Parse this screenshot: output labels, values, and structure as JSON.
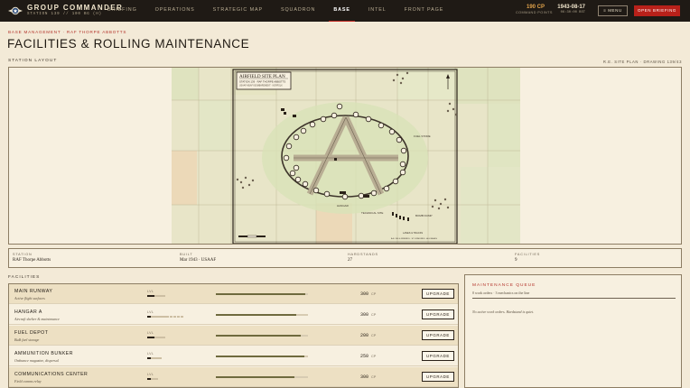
{
  "app": {
    "title": "GROUP COMMANDER",
    "subtitle": "STATION 139 // 100 BG (H)"
  },
  "nav": {
    "items": [
      {
        "label": "BRIEFING",
        "active": false
      },
      {
        "label": "OPERATIONS",
        "active": false
      },
      {
        "label": "STRATEGIC MAP",
        "active": false
      },
      {
        "label": "SQUADRON",
        "active": false
      },
      {
        "label": "BASE",
        "active": true
      },
      {
        "label": "INTEL",
        "active": false
      },
      {
        "label": "FRONT PAGE",
        "active": false
      }
    ]
  },
  "status": {
    "cp_value": "190 CP",
    "cp_label": "COMMAND POINTS",
    "date": "1943-08-17",
    "time": "06:30:00 BST",
    "menu_label": "≡ MENU",
    "briefing_label": "OPEN BRIEFING"
  },
  "header": {
    "breadcrumb": "BASE MANAGEMENT · RAF THORPE ABBOTTS",
    "title": "FACILITIES & ROLLING MAINTENANCE"
  },
  "layout_section": {
    "label": "STATION LAYOUT",
    "drawing_ref": "R.E. SITE PLAN · DRAWING 139/43"
  },
  "site_plan": {
    "title": "AIRFIELD SITE PLAN",
    "line1": "STATION 139 · RAF THORPE ABBOTTS",
    "line2": "USAAF HEAVY BOMBARDMENT · NORFOLK",
    "labels": {
      "fuel_store": "FUEL STORE",
      "hangar": "HANGAR",
      "technical_site": "TECHNICAL SITE",
      "bomb_dump": "BOMB DUMP",
      "lanes": "LANES & TRACKS",
      "footer": "A.E. 306 & FRIENDS · ST. EDMUNDS · ALL BASES"
    }
  },
  "stats": [
    {
      "label": "STATION",
      "value": "RAF Thorpe Abbotts"
    },
    {
      "label": "BUILT",
      "value": "Mar 1943 · USAAF"
    },
    {
      "label": "HARDSTANDS",
      "value": "27"
    },
    {
      "label": "FACILITIES",
      "value": "9"
    }
  ],
  "facilities_section": {
    "label": "FACILITIES"
  },
  "facilities": [
    {
      "name": "MAIN RUNWAY",
      "desc": "Active flight surfaces",
      "lvl_label": "LVL",
      "level": 2,
      "level_max": 5,
      "condition": 0.97,
      "cost": "300",
      "unit": "CP",
      "button": "UPGRADE"
    },
    {
      "name": "HANGAR A",
      "desc": "Aircraft shelter & maintenance",
      "lvl_label": "LVL",
      "level": 1,
      "level_max": 10,
      "condition": 0.87,
      "cost": "300",
      "unit": "CP",
      "button": "UPGRADE"
    },
    {
      "name": "FUEL DEPOT",
      "desc": "Bulk fuel storage",
      "lvl_label": "LVL",
      "level": 2,
      "level_max": 5,
      "condition": 0.92,
      "cost": "200",
      "unit": "CP",
      "button": "UPGRADE"
    },
    {
      "name": "AMMUNITION BUNKER",
      "desc": "Ordnance magazine, dispersal",
      "lvl_label": "LVL",
      "level": 1,
      "level_max": 4,
      "condition": 0.96,
      "cost": "250",
      "unit": "CP",
      "button": "UPGRADE"
    },
    {
      "name": "COMMUNICATIONS CENTER",
      "desc": "Field comms relay",
      "lvl_label": "LVL",
      "level": 1,
      "level_max": 3,
      "condition": 0.85,
      "cost": "300",
      "unit": "CP",
      "button": "UPGRADE"
    }
  ],
  "maintenance": {
    "title": "MAINTENANCE QUEUE",
    "subtitle": "0 work orders · 3 mechanics on the line",
    "empty": "No active work orders. Hardstand is quiet."
  },
  "colors": {
    "accent": "#b8211a",
    "topbar": "#1f1a15",
    "paper": "#f3ead7",
    "condition_fill": "#6f6a3e"
  }
}
